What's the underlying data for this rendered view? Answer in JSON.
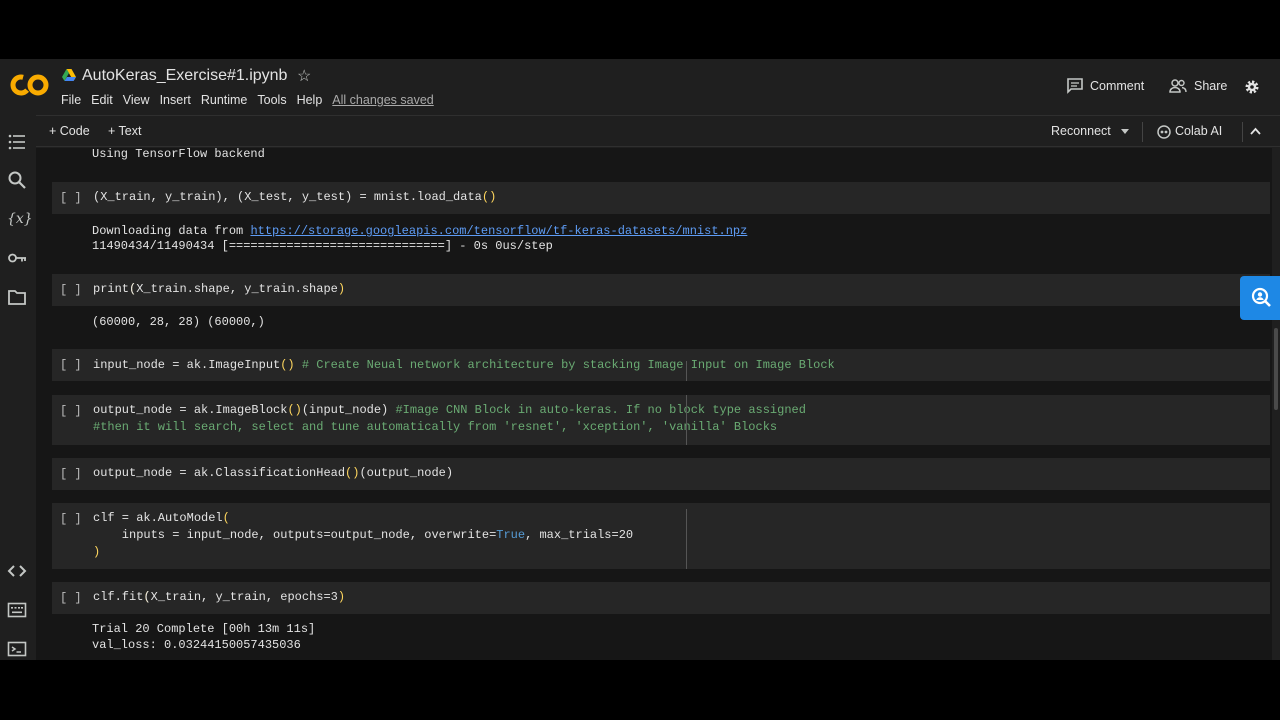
{
  "header": {
    "title": "AutoKeras_Exercise#1.ipynb",
    "menu": [
      "File",
      "Edit",
      "View",
      "Insert",
      "Runtime",
      "Tools",
      "Help"
    ],
    "saved_status": "All changes saved",
    "comment_label": "Comment",
    "share_label": "Share"
  },
  "toolbar": {
    "add_code_label": "+ Code",
    "add_text_label": "+ Text",
    "reconnect_label": "Reconnect",
    "colab_ai_label": "Colab AI"
  },
  "cells": {
    "run_marker": "[ ]",
    "output0": "Using TensorFlow backend",
    "cell1": {
      "code_a": "(X_train, y_train), (X_test, y_test) = mnist.load_data",
      "paren": "()",
      "out_prefix": "Downloading data from ",
      "out_link": "https://storage.googleapis.com/tensorflow/tf-keras-datasets/mnist.npz",
      "out_line2": "11490434/11490434 [==============================] - 0s 0us/step"
    },
    "cell2": {
      "code_a": "print",
      "code_b": "(X_train.shape, y_train.shape",
      "code_c": ")",
      "output": "(60000, 28, 28) (60000,)"
    },
    "cell3": {
      "code_a": "input_node = ak.ImageInput",
      "paren": "()",
      "comment": " # Create Neual network architecture by stacking Image Input on Image Block"
    },
    "cell4": {
      "code_a": "output_node = ak.ImageBlock",
      "paren": "()",
      "code_b": "(input_node)",
      "comment1": " #Image CNN Block in auto-keras. If no block type assigned",
      "comment2": "#then it will search, select and tune automatically from 'resnet', 'xception', 'vanilla' Blocks"
    },
    "cell5": {
      "code_a": "output_node = ak.ClassificationHead",
      "paren": "()",
      "code_b": "(output_node)"
    },
    "cell6": {
      "line1_a": "clf = ak.AutoModel",
      "line1_b": "(",
      "line2_a": "    inputs = input_node, outputs=output_node, overwrite=",
      "line2_kw": "True",
      "line2_b": ", max_trials=20",
      "line3": ")"
    },
    "cell7": {
      "code_a": "clf.fit",
      "code_b": "(X_train, y_train, epochs=3",
      "code_c": ")",
      "out_line1": "Trial 20 Complete [00h 13m 11s]",
      "out_line2": "val_loss: 0.03244150057435036"
    }
  },
  "colors": {
    "background": "#1f1f1f",
    "cell_bg": "#262626",
    "paren": "#ffd75f",
    "comment": "#6aab73",
    "keyword": "#569cd6",
    "link": "#5e9cf5",
    "logo_orange": "#f9ab00"
  },
  "icons": [
    "colab-logo",
    "google-drive-icon",
    "star-icon",
    "comment-icon",
    "share-people-icon",
    "settings-gear-icon",
    "table-of-contents-icon",
    "search-icon",
    "variables-icon",
    "secrets-key-icon",
    "files-folder-icon",
    "code-snippets-icon",
    "command-palette-icon",
    "terminal-icon",
    "dropdown-arrow-icon",
    "collapse-chevron-icon",
    "magnifier-icon"
  ]
}
